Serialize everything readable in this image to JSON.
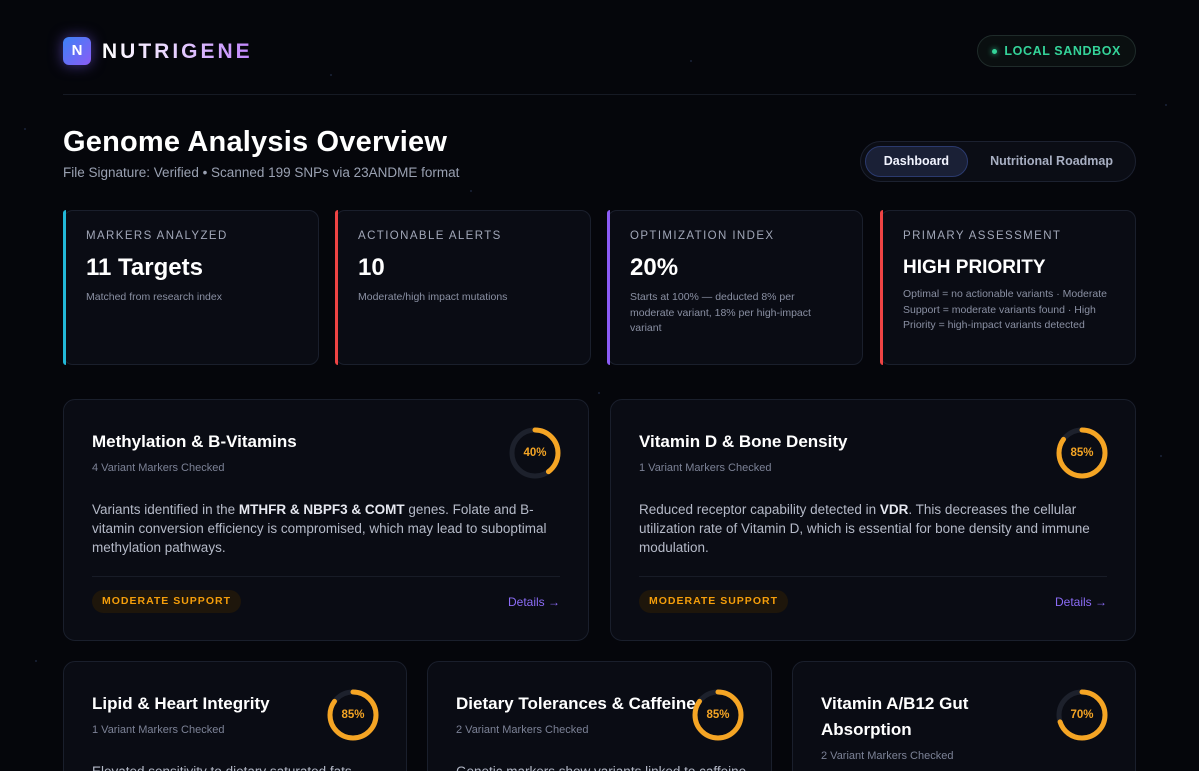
{
  "brand": {
    "logo_letter": "N",
    "name": "NUTRIGENE"
  },
  "environment_badge": "LOCAL SANDBOX",
  "page": {
    "title": "Genome Analysis Overview",
    "subtitle": "File Signature: Verified • Scanned 199 SNPs via 23ANDME format"
  },
  "tabs": [
    {
      "label": "Dashboard",
      "active": true
    },
    {
      "label": "Nutritional Roadmap",
      "active": false
    }
  ],
  "stats": [
    {
      "label": "MARKERS ANALYZED",
      "value": "11 Targets",
      "desc": "Matched from research index",
      "accent": "#22b8d8"
    },
    {
      "label": "ACTIONABLE ALERTS",
      "value": "10",
      "desc": "Moderate/high impact mutations",
      "accent": "#ef4444"
    },
    {
      "label": "OPTIMIZATION INDEX",
      "value": "20%",
      "desc": "Starts at 100% — deducted 8% per moderate variant, 18% per high-impact variant",
      "accent": "#8b5cf6"
    },
    {
      "label": "PRIMARY ASSESSMENT",
      "value": "HIGH PRIORITY",
      "desc": "Optimal = no actionable variants · Moderate Support = moderate variants found · High Priority = high-impact variants detected",
      "accent": "#ef4444"
    }
  ],
  "cards": [
    {
      "title": "Methylation & B-Vitamins",
      "markers": "4 Variant Markers Checked",
      "score": 40,
      "score_label": "40%",
      "body_pre": "Variants identified in the ",
      "body_bold": "MTHFR & NBPF3 & COMT",
      "body_post": " genes. Folate and B-vitamin conversion efficiency is compromised, which may lead to suboptimal methylation pathways.",
      "badge": "MODERATE SUPPORT",
      "link": "Details →"
    },
    {
      "title": "Vitamin D & Bone Density",
      "markers": "1 Variant Markers Checked",
      "score": 85,
      "score_label": "85%",
      "body_pre": "Reduced receptor capability detected in ",
      "body_bold": "VDR",
      "body_post": ". This decreases the cellular utilization rate of Vitamin D, which is essential for bone density and immune modulation.",
      "badge": "MODERATE SUPPORT",
      "link": "Details →"
    },
    {
      "title": "Lipid & Heart Integrity",
      "markers": "1 Variant Markers Checked",
      "score": 85,
      "score_label": "85%",
      "body_pre": "Elevated sensitivity to dietary saturated fats"
    },
    {
      "title": "Dietary Tolerances & Caffeine",
      "markers": "2 Variant Markers Checked",
      "score": 85,
      "score_label": "85%",
      "body_pre": "Genetic markers show variants linked to caffeine"
    },
    {
      "title": "Vitamin A/B12 Gut Absorption",
      "markers": "2 Variant Markers Checked",
      "score": 70,
      "score_label": "70%"
    }
  ],
  "colors": {
    "ring": "#f5a524",
    "ring_track": "#1d212c",
    "link": "#8b6cf6"
  }
}
